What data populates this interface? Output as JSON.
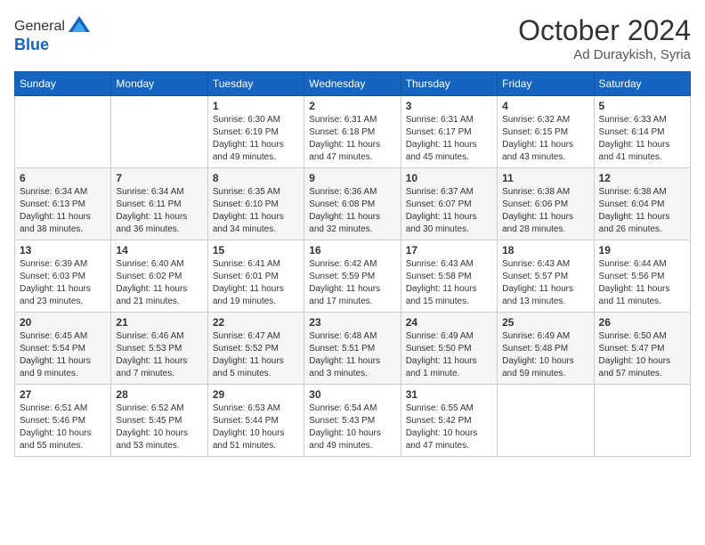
{
  "logo": {
    "general": "General",
    "blue": "Blue"
  },
  "header": {
    "month": "October 2024",
    "location": "Ad Duraykish, Syria"
  },
  "weekdays": [
    "Sunday",
    "Monday",
    "Tuesday",
    "Wednesday",
    "Thursday",
    "Friday",
    "Saturday"
  ],
  "weeks": [
    [
      {
        "day": "",
        "sunrise": "",
        "sunset": "",
        "daylight": ""
      },
      {
        "day": "",
        "sunrise": "",
        "sunset": "",
        "daylight": ""
      },
      {
        "day": "1",
        "sunrise": "Sunrise: 6:30 AM",
        "sunset": "Sunset: 6:19 PM",
        "daylight": "Daylight: 11 hours and 49 minutes."
      },
      {
        "day": "2",
        "sunrise": "Sunrise: 6:31 AM",
        "sunset": "Sunset: 6:18 PM",
        "daylight": "Daylight: 11 hours and 47 minutes."
      },
      {
        "day": "3",
        "sunrise": "Sunrise: 6:31 AM",
        "sunset": "Sunset: 6:17 PM",
        "daylight": "Daylight: 11 hours and 45 minutes."
      },
      {
        "day": "4",
        "sunrise": "Sunrise: 6:32 AM",
        "sunset": "Sunset: 6:15 PM",
        "daylight": "Daylight: 11 hours and 43 minutes."
      },
      {
        "day": "5",
        "sunrise": "Sunrise: 6:33 AM",
        "sunset": "Sunset: 6:14 PM",
        "daylight": "Daylight: 11 hours and 41 minutes."
      }
    ],
    [
      {
        "day": "6",
        "sunrise": "Sunrise: 6:34 AM",
        "sunset": "Sunset: 6:13 PM",
        "daylight": "Daylight: 11 hours and 38 minutes."
      },
      {
        "day": "7",
        "sunrise": "Sunrise: 6:34 AM",
        "sunset": "Sunset: 6:11 PM",
        "daylight": "Daylight: 11 hours and 36 minutes."
      },
      {
        "day": "8",
        "sunrise": "Sunrise: 6:35 AM",
        "sunset": "Sunset: 6:10 PM",
        "daylight": "Daylight: 11 hours and 34 minutes."
      },
      {
        "day": "9",
        "sunrise": "Sunrise: 6:36 AM",
        "sunset": "Sunset: 6:08 PM",
        "daylight": "Daylight: 11 hours and 32 minutes."
      },
      {
        "day": "10",
        "sunrise": "Sunrise: 6:37 AM",
        "sunset": "Sunset: 6:07 PM",
        "daylight": "Daylight: 11 hours and 30 minutes."
      },
      {
        "day": "11",
        "sunrise": "Sunrise: 6:38 AM",
        "sunset": "Sunset: 6:06 PM",
        "daylight": "Daylight: 11 hours and 28 minutes."
      },
      {
        "day": "12",
        "sunrise": "Sunrise: 6:38 AM",
        "sunset": "Sunset: 6:04 PM",
        "daylight": "Daylight: 11 hours and 26 minutes."
      }
    ],
    [
      {
        "day": "13",
        "sunrise": "Sunrise: 6:39 AM",
        "sunset": "Sunset: 6:03 PM",
        "daylight": "Daylight: 11 hours and 23 minutes."
      },
      {
        "day": "14",
        "sunrise": "Sunrise: 6:40 AM",
        "sunset": "Sunset: 6:02 PM",
        "daylight": "Daylight: 11 hours and 21 minutes."
      },
      {
        "day": "15",
        "sunrise": "Sunrise: 6:41 AM",
        "sunset": "Sunset: 6:01 PM",
        "daylight": "Daylight: 11 hours and 19 minutes."
      },
      {
        "day": "16",
        "sunrise": "Sunrise: 6:42 AM",
        "sunset": "Sunset: 5:59 PM",
        "daylight": "Daylight: 11 hours and 17 minutes."
      },
      {
        "day": "17",
        "sunrise": "Sunrise: 6:43 AM",
        "sunset": "Sunset: 5:58 PM",
        "daylight": "Daylight: 11 hours and 15 minutes."
      },
      {
        "day": "18",
        "sunrise": "Sunrise: 6:43 AM",
        "sunset": "Sunset: 5:57 PM",
        "daylight": "Daylight: 11 hours and 13 minutes."
      },
      {
        "day": "19",
        "sunrise": "Sunrise: 6:44 AM",
        "sunset": "Sunset: 5:56 PM",
        "daylight": "Daylight: 11 hours and 11 minutes."
      }
    ],
    [
      {
        "day": "20",
        "sunrise": "Sunrise: 6:45 AM",
        "sunset": "Sunset: 5:54 PM",
        "daylight": "Daylight: 11 hours and 9 minutes."
      },
      {
        "day": "21",
        "sunrise": "Sunrise: 6:46 AM",
        "sunset": "Sunset: 5:53 PM",
        "daylight": "Daylight: 11 hours and 7 minutes."
      },
      {
        "day": "22",
        "sunrise": "Sunrise: 6:47 AM",
        "sunset": "Sunset: 5:52 PM",
        "daylight": "Daylight: 11 hours and 5 minutes."
      },
      {
        "day": "23",
        "sunrise": "Sunrise: 6:48 AM",
        "sunset": "Sunset: 5:51 PM",
        "daylight": "Daylight: 11 hours and 3 minutes."
      },
      {
        "day": "24",
        "sunrise": "Sunrise: 6:49 AM",
        "sunset": "Sunset: 5:50 PM",
        "daylight": "Daylight: 11 hours and 1 minute."
      },
      {
        "day": "25",
        "sunrise": "Sunrise: 6:49 AM",
        "sunset": "Sunset: 5:48 PM",
        "daylight": "Daylight: 10 hours and 59 minutes."
      },
      {
        "day": "26",
        "sunrise": "Sunrise: 6:50 AM",
        "sunset": "Sunset: 5:47 PM",
        "daylight": "Daylight: 10 hours and 57 minutes."
      }
    ],
    [
      {
        "day": "27",
        "sunrise": "Sunrise: 6:51 AM",
        "sunset": "Sunset: 5:46 PM",
        "daylight": "Daylight: 10 hours and 55 minutes."
      },
      {
        "day": "28",
        "sunrise": "Sunrise: 6:52 AM",
        "sunset": "Sunset: 5:45 PM",
        "daylight": "Daylight: 10 hours and 53 minutes."
      },
      {
        "day": "29",
        "sunrise": "Sunrise: 6:53 AM",
        "sunset": "Sunset: 5:44 PM",
        "daylight": "Daylight: 10 hours and 51 minutes."
      },
      {
        "day": "30",
        "sunrise": "Sunrise: 6:54 AM",
        "sunset": "Sunset: 5:43 PM",
        "daylight": "Daylight: 10 hours and 49 minutes."
      },
      {
        "day": "31",
        "sunrise": "Sunrise: 6:55 AM",
        "sunset": "Sunset: 5:42 PM",
        "daylight": "Daylight: 10 hours and 47 minutes."
      },
      {
        "day": "",
        "sunrise": "",
        "sunset": "",
        "daylight": ""
      },
      {
        "day": "",
        "sunrise": "",
        "sunset": "",
        "daylight": ""
      }
    ]
  ]
}
